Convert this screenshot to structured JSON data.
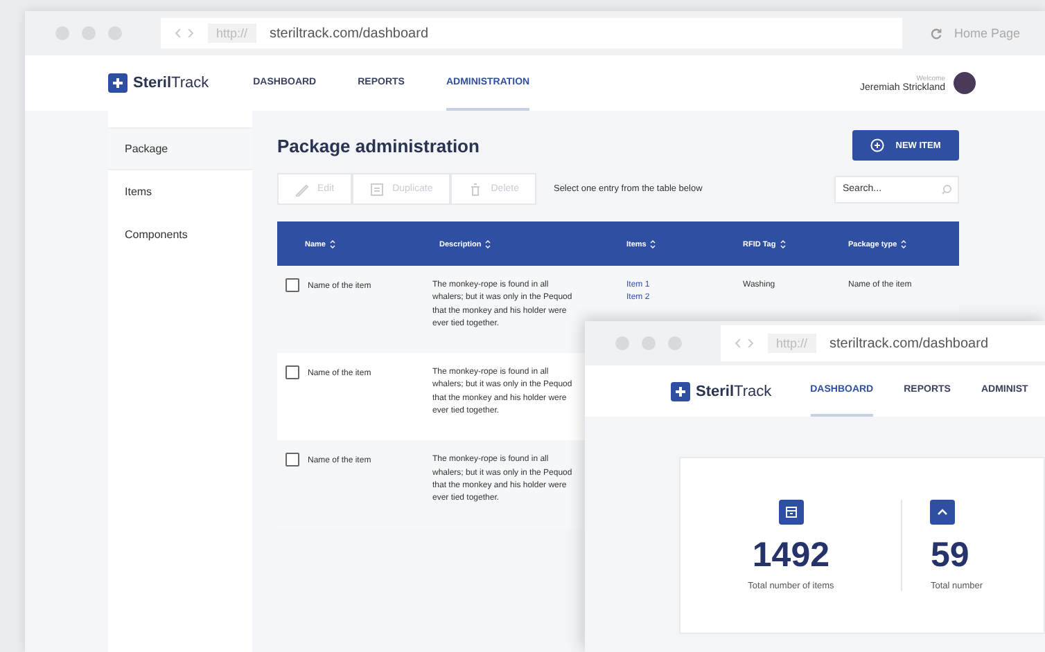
{
  "back_window": {
    "browser": {
      "protocol": "http://",
      "url": "steriltrack.com/dashboard",
      "home": "Home Page"
    },
    "logo": "**Steril**Track",
    "nav": [
      {
        "label": "DASHBOARD",
        "selected": false
      },
      {
        "label": "REPORTS",
        "selected": false
      },
      {
        "label": "ADMINISTRATION",
        "selected": true
      }
    ],
    "user": {
      "welcome": "Welcome",
      "name": "Jeremiah Strickland"
    },
    "sidebar": {
      "items": [
        {
          "label": "Package",
          "selected": true
        },
        {
          "label": "Items",
          "selected": false
        },
        {
          "label": "Components",
          "selected": false
        }
      ]
    },
    "title": "Package administration",
    "new_button": "NEW ITEM",
    "toolbar": [
      {
        "kind": "edit",
        "label": "Edit",
        "disabled": true
      },
      {
        "kind": "duplicate",
        "label": "Duplicate",
        "disabled": true
      },
      {
        "kind": "delete",
        "label": "Delete",
        "disabled": true
      }
    ],
    "hint": "Select one entry from the table below",
    "search": {
      "placeholder": "Search..."
    },
    "table": {
      "columns": [
        "Name",
        "Description",
        "Items",
        "RFID Tag",
        "Package type"
      ],
      "rows": [
        {
          "checked": false,
          "name": "Name of the item",
          "description": "The monkey-rope is found in all whalers; but it was only in the Pequod that the monkey and his holder were ever tied together.",
          "items": [
            "Item 1",
            "Item 2"
          ],
          "rfid_tag": "Washing",
          "package_type": "Name of the item"
        },
        {
          "checked": false,
          "name": "Name of the item",
          "description": "The monkey-rope is found in all whalers; but it was only in the Pequod that the monkey and his holder were ever tied together."
        },
        {
          "checked": false,
          "name": "Name of the item",
          "description": "The monkey-rope is found in all whalers; but it was only in the Pequod that the monkey and his holder were ever tied together."
        }
      ]
    }
  },
  "front_window": {
    "browser": {
      "protocol": "http://",
      "url": "steriltrack.com/dashboard"
    },
    "logo": "**Steril**Track",
    "nav": [
      {
        "label": "DASHBOARD",
        "selected": true
      },
      {
        "label": "REPORTS",
        "selected": false
      },
      {
        "label": "ADMINIST",
        "selected": false
      }
    ],
    "stats": [
      {
        "kind": "box",
        "value": "1492",
        "label": "Total number of items"
      },
      {
        "kind": "chevron",
        "value": "59",
        "label": "Total number"
      }
    ]
  }
}
